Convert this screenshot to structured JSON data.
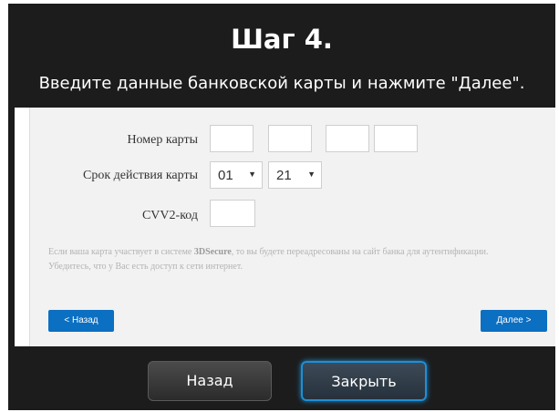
{
  "header": {
    "title": "Шаг 4.",
    "subtitle": "Введите данные банковской карты и нажмите \"Далее\"."
  },
  "form": {
    "card_number_label": "Номер карты",
    "expiry_label": "Срок действия карты",
    "expiry_month": "01",
    "expiry_year": "21",
    "cvv_label": "CVV2-код",
    "card_number_values": [
      "",
      "",
      "",
      ""
    ],
    "cvv_value": ""
  },
  "note": {
    "part1": "Если ваша карта участвует в системе ",
    "bold": "3DSecure",
    "part2": ", то вы будете переадресованы на сайт банка для аутентификации. Убедитесь, что у Вас есть доступ к сети интернет."
  },
  "panel_buttons": {
    "back": "< Назад",
    "next": "Далее >"
  },
  "footer": {
    "back": "Назад",
    "close": "Закрыть"
  },
  "colors": {
    "dialog_bg": "#1c1c1c",
    "panel_bg": "#f2f2f2",
    "accent_blue": "#0b6fc2"
  }
}
